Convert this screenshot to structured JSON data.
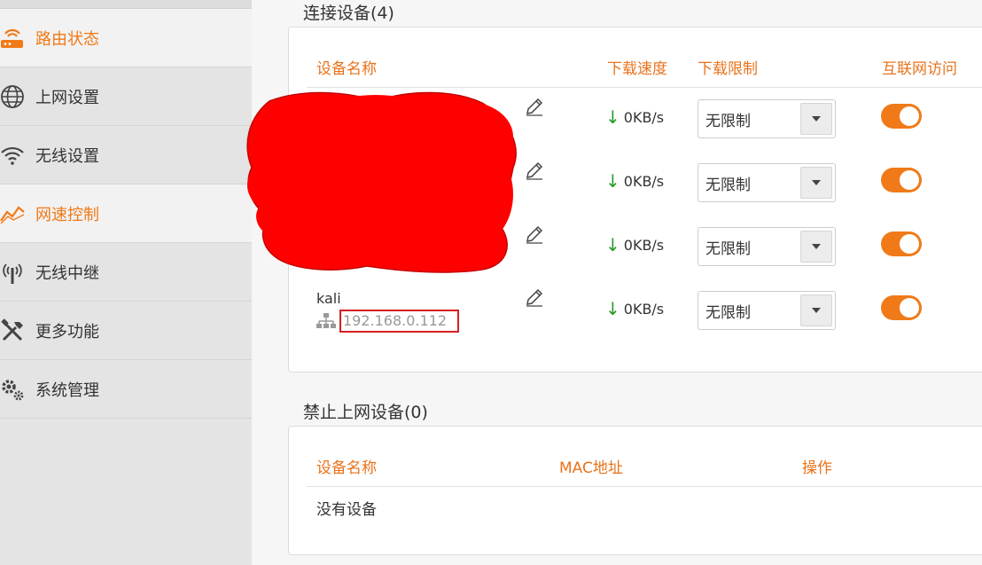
{
  "sidebar": {
    "items": [
      {
        "label": "路由状态",
        "icon": "router-status-icon",
        "active": true
      },
      {
        "label": "上网设置",
        "icon": "globe-icon",
        "active": false
      },
      {
        "label": "无线设置",
        "icon": "wifi-icon",
        "active": false
      },
      {
        "label": "网速控制",
        "icon": "speed-graph-icon",
        "active": false
      },
      {
        "label": "无线中继",
        "icon": "repeater-antenna-icon",
        "active": false
      },
      {
        "label": "更多功能",
        "icon": "tools-icon",
        "active": false
      },
      {
        "label": "系统管理",
        "icon": "gears-icon",
        "active": false
      }
    ]
  },
  "connected": {
    "title": "连接设备(4)",
    "headers": {
      "name": "设备名称",
      "speed": "下载速度",
      "limit": "下载限制",
      "internet": "互联网访问"
    },
    "devices": [
      {
        "name": "",
        "ip": "",
        "speed": "0KB/s",
        "limit": "无限制",
        "internet_on": true
      },
      {
        "name": "",
        "ip": "",
        "speed": "0KB/s",
        "limit": "无限制",
        "internet_on": true
      },
      {
        "name": "",
        "ip": "",
        "speed": "0KB/s",
        "limit": "无限制",
        "internet_on": true
      },
      {
        "name": "kali",
        "ip": "192.168.0.112",
        "speed": "0KB/s",
        "limit": "无限制",
        "internet_on": true
      }
    ],
    "speed_arrow": "↓"
  },
  "blocked": {
    "title": "禁止上网设备(0)",
    "headers": {
      "name": "设备名称",
      "mac": "MAC地址",
      "action": "操作"
    },
    "empty_text": "没有设备"
  },
  "colors": {
    "accent": "#f07a18",
    "header_text": "#e8731c",
    "download_arrow": "#2a9b2a",
    "redaction": "#ff0000",
    "highlight_box": "#d62020"
  }
}
